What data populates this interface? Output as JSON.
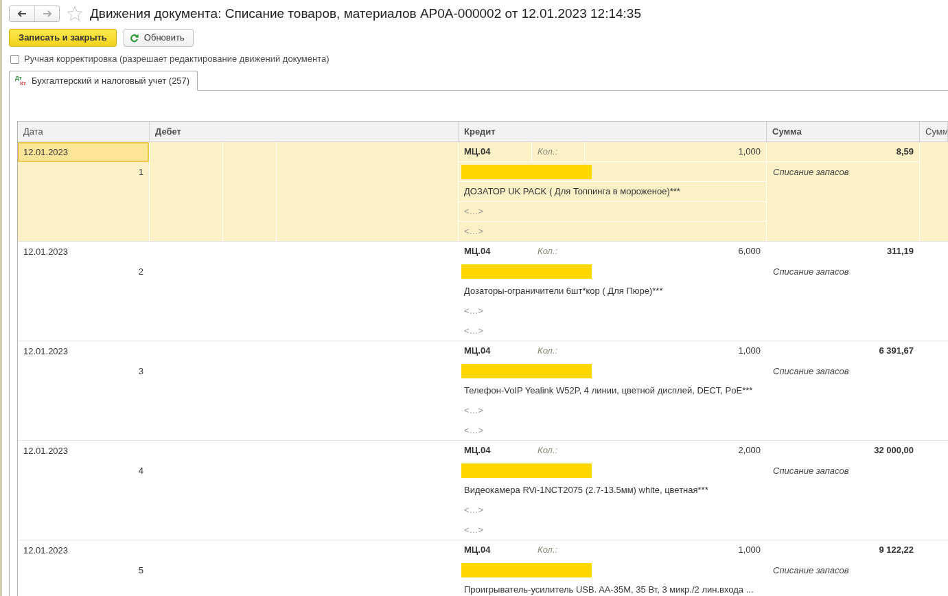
{
  "header": {
    "nav": [
      {
        "kind": "back",
        "disabled": false
      },
      {
        "kind": "forward",
        "disabled": true
      }
    ],
    "favorite": false,
    "title": "Движения документа: Списание товаров, материалов AP0A-000002 от 12.01.2023 12:14:35"
  },
  "buttons": [
    {
      "kind": "primary",
      "label": "Записать и закрыть"
    },
    {
      "kind": "refresh",
      "label": "Обновить"
    }
  ],
  "manual_edit": {
    "label": "Ручная корректировка (разрешает редактирование движений документа)",
    "checked": false
  },
  "tabs": [
    {
      "icon_debit": "Дт",
      "icon_credit": "Кт",
      "label": "Бухгалтерский и налоговый учет (257)",
      "selected": true
    }
  ],
  "table": {
    "columns": [
      {
        "label": "Дата",
        "bold": false
      },
      {
        "label": "Дебет",
        "bold": true
      },
      {
        "label": "Кредит",
        "bold": true
      },
      {
        "label": "Сумма",
        "bold": true
      },
      {
        "label": "Сумм",
        "bold": false
      }
    ],
    "rows": [
      {
        "selected": true,
        "date_focused": true,
        "date": "12.01.2023",
        "number": "1",
        "credit_account": "МЦ.04",
        "qty_label": "Кол.:",
        "qty": "1,000",
        "subconto": [
          {
            "kind": "redacted"
          },
          {
            "kind": "text",
            "text": "ДОЗАТОР UK PACK ( Для Топпинга в мороженое)***"
          },
          {
            "kind": "placeholder",
            "text": "<…>"
          },
          {
            "kind": "placeholder",
            "text": "<…>"
          }
        ],
        "amount": "8,59",
        "content": "Списание запасов"
      },
      {
        "selected": false,
        "date_focused": false,
        "date": "12.01.2023",
        "number": "2",
        "credit_account": "МЦ.04",
        "qty_label": "Кол.:",
        "qty": "6,000",
        "subconto": [
          {
            "kind": "redacted"
          },
          {
            "kind": "text",
            "text": "Дозаторы-ограничители 6шт*кор ( Для Пюре)***"
          },
          {
            "kind": "placeholder",
            "text": "<…>"
          },
          {
            "kind": "placeholder",
            "text": "<…>"
          }
        ],
        "amount": "311,19",
        "content": "Списание запасов"
      },
      {
        "selected": false,
        "date_focused": false,
        "date": "12.01.2023",
        "number": "3",
        "credit_account": "МЦ.04",
        "qty_label": "Кол.:",
        "qty": "1,000",
        "subconto": [
          {
            "kind": "redacted"
          },
          {
            "kind": "text",
            "text": "Телефон-VoIP Yealink W52P, 4 линии, цветной дисплей, DECT, PoE***"
          },
          {
            "kind": "placeholder",
            "text": "<…>"
          },
          {
            "kind": "placeholder",
            "text": "<…>"
          }
        ],
        "amount": "6 391,67",
        "content": "Списание запасов"
      },
      {
        "selected": false,
        "date_focused": false,
        "date": "12.01.2023",
        "number": "4",
        "credit_account": "МЦ.04",
        "qty_label": "Кол.:",
        "qty": "2,000",
        "subconto": [
          {
            "kind": "redacted"
          },
          {
            "kind": "text",
            "text": "Видеокамера RVi-1NCT2075 (2.7-13.5мм) white, цветная***"
          },
          {
            "kind": "placeholder",
            "text": "<…>"
          },
          {
            "kind": "placeholder",
            "text": "<…>"
          }
        ],
        "amount": "32 000,00",
        "content": "Списание запасов"
      },
      {
        "selected": false,
        "date_focused": false,
        "date": "12.01.2023",
        "number": "5",
        "credit_account": "МЦ.04",
        "qty_label": "Кол.:",
        "qty": "1,000",
        "subconto": [
          {
            "kind": "redacted"
          },
          {
            "kind": "text",
            "text": "Проигрыватель-усилитель USB. AA-35M, 35 Вт, 3 микр./2 лин.входа ..."
          }
        ],
        "amount": "9 122,22",
        "content": "Списание запасов"
      }
    ]
  }
}
